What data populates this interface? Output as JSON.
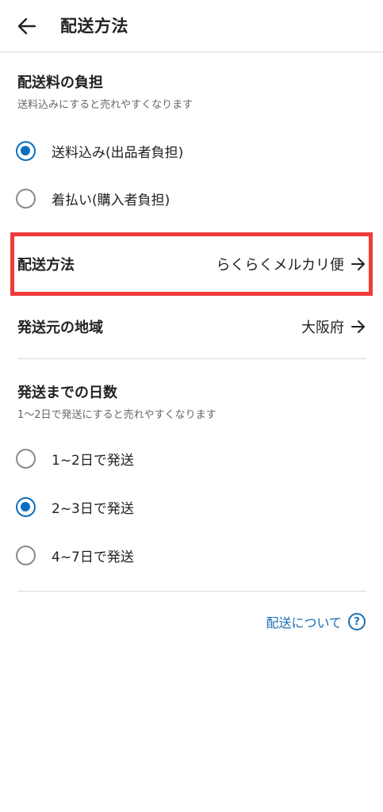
{
  "header": {
    "title": "配送方法"
  },
  "shipping_fee": {
    "title": "配送料の負担",
    "subtitle": "送料込みにすると売れやすくなります",
    "options": [
      {
        "label": "送料込み(出品者負担)",
        "selected": true
      },
      {
        "label": "着払い(購入者負担)",
        "selected": false
      }
    ]
  },
  "method": {
    "label": "配送方法",
    "value": "らくらくメルカリ便"
  },
  "origin": {
    "label": "発送元の地域",
    "value": "大阪府"
  },
  "days": {
    "title": "発送までの日数",
    "subtitle": "1〜2日で発送にすると売れやすくなります",
    "options": [
      {
        "label": "1~2日で発送",
        "selected": false
      },
      {
        "label": "2~3日で発送",
        "selected": true
      },
      {
        "label": "4~7日で発送",
        "selected": false
      }
    ]
  },
  "help": {
    "label": "配送について",
    "icon_text": "?"
  },
  "colors": {
    "accent": "#0b6fbf",
    "highlight": "#f03a3a",
    "link": "#1a6eb5"
  }
}
